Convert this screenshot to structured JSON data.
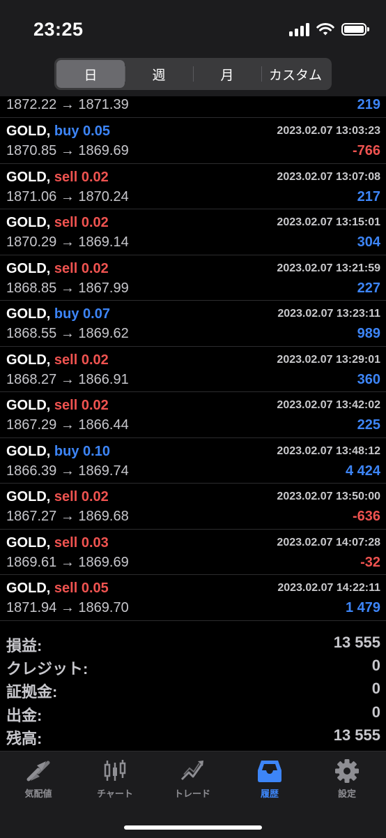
{
  "status": {
    "time": "23:25"
  },
  "period_tabs": [
    {
      "label": "日",
      "active": true
    },
    {
      "label": "週",
      "active": false
    },
    {
      "label": "月",
      "active": false
    },
    {
      "label": "カスタム",
      "active": false
    }
  ],
  "partial_row": {
    "prices": "1872.22 → 1871.39",
    "profit": "219"
  },
  "deals": [
    {
      "symbol": "GOLD,",
      "type": "buy",
      "volume": "buy 0.05",
      "time": "2023.02.07 13:03:23",
      "prices": "1870.85 → 1869.69",
      "profit": "-766"
    },
    {
      "symbol": "GOLD,",
      "type": "sell",
      "volume": "sell 0.02",
      "time": "2023.02.07 13:07:08",
      "prices": "1871.06 → 1870.24",
      "profit": "217"
    },
    {
      "symbol": "GOLD,",
      "type": "sell",
      "volume": "sell 0.02",
      "time": "2023.02.07 13:15:01",
      "prices": "1870.29 → 1869.14",
      "profit": "304"
    },
    {
      "symbol": "GOLD,",
      "type": "sell",
      "volume": "sell 0.02",
      "time": "2023.02.07 13:21:59",
      "prices": "1868.85 → 1867.99",
      "profit": "227"
    },
    {
      "symbol": "GOLD,",
      "type": "buy",
      "volume": "buy 0.07",
      "time": "2023.02.07 13:23:11",
      "prices": "1868.55 → 1869.62",
      "profit": "989"
    },
    {
      "symbol": "GOLD,",
      "type": "sell",
      "volume": "sell 0.02",
      "time": "2023.02.07 13:29:01",
      "prices": "1868.27 → 1866.91",
      "profit": "360"
    },
    {
      "symbol": "GOLD,",
      "type": "sell",
      "volume": "sell 0.02",
      "time": "2023.02.07 13:42:02",
      "prices": "1867.29 → 1866.44",
      "profit": "225"
    },
    {
      "symbol": "GOLD,",
      "type": "buy",
      "volume": "buy 0.10",
      "time": "2023.02.07 13:48:12",
      "prices": "1866.39 → 1869.74",
      "profit": "4 424"
    },
    {
      "symbol": "GOLD,",
      "type": "sell",
      "volume": "sell 0.02",
      "time": "2023.02.07 13:50:00",
      "prices": "1867.27 → 1869.68",
      "profit": "-636"
    },
    {
      "symbol": "GOLD,",
      "type": "sell",
      "volume": "sell 0.03",
      "time": "2023.02.07 14:07:28",
      "prices": "1869.61 → 1869.69",
      "profit": "-32"
    },
    {
      "symbol": "GOLD,",
      "type": "sell",
      "volume": "sell 0.05",
      "time": "2023.02.07 14:22:11",
      "prices": "1871.94 → 1869.70",
      "profit": "1 479"
    }
  ],
  "summary": [
    {
      "label": "損益:",
      "value": "13 555"
    },
    {
      "label": "クレジット:",
      "value": "0"
    },
    {
      "label": "証拠金:",
      "value": "0"
    },
    {
      "label": "出金:",
      "value": "0"
    },
    {
      "label": "残高:",
      "value": "13 555"
    }
  ],
  "bottom_tabs": [
    {
      "label": "気配値",
      "icon": "quotes-icon",
      "active": false
    },
    {
      "label": "チャート",
      "icon": "chart-icon",
      "active": false
    },
    {
      "label": "トレード",
      "icon": "trade-icon",
      "active": false
    },
    {
      "label": "履歴",
      "icon": "history-icon",
      "active": true
    },
    {
      "label": "設定",
      "icon": "settings-icon",
      "active": false
    }
  ],
  "colors": {
    "buy": "#3d85f7",
    "sell": "#ef5350",
    "profit_positive": "#3d85f7",
    "profit_negative": "#ef5350",
    "active_tab": "#3d85f7"
  }
}
